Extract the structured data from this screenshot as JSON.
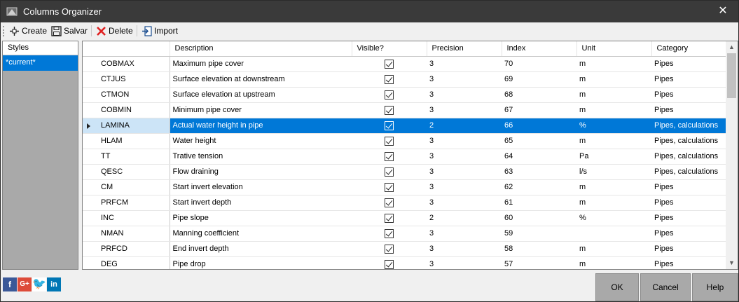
{
  "window": {
    "title": "Columns Organizer",
    "close_glyph": "✕"
  },
  "toolbar": {
    "create_label": "Create",
    "save_label": "Salvar",
    "delete_label": "Delete",
    "import_label": "Import"
  },
  "styles": {
    "header": "Styles",
    "items": [
      {
        "label": "*current*",
        "selected": true
      }
    ]
  },
  "grid": {
    "headers": {
      "description": "Description",
      "visible": "Visible?",
      "precision": "Precision",
      "index": "Index",
      "unit": "Unit",
      "category": "Category"
    },
    "rows": [
      {
        "name": "COBMAX",
        "description": "Maximum pipe cover",
        "visible": true,
        "precision": "3",
        "index": "70",
        "unit": "m",
        "category": "Pipes"
      },
      {
        "name": "CTJUS",
        "description": "Surface elevation at downstream",
        "visible": true,
        "precision": "3",
        "index": "69",
        "unit": "m",
        "category": "Pipes"
      },
      {
        "name": "CTMON",
        "description": "Surface elevation at upstream",
        "visible": true,
        "precision": "3",
        "index": "68",
        "unit": "m",
        "category": "Pipes"
      },
      {
        "name": "COBMIN",
        "description": "Minimum pipe cover",
        "visible": true,
        "precision": "3",
        "index": "67",
        "unit": "m",
        "category": "Pipes"
      },
      {
        "name": "LAMINA",
        "description": "Actual water height in pipe",
        "visible": true,
        "precision": "2",
        "index": "66",
        "unit": "%",
        "category": "Pipes, calculations",
        "selected": true
      },
      {
        "name": "HLAM",
        "description": "Water height",
        "visible": true,
        "precision": "3",
        "index": "65",
        "unit": "m",
        "category": "Pipes, calculations"
      },
      {
        "name": "TT",
        "description": "Trative tension",
        "visible": true,
        "precision": "3",
        "index": "64",
        "unit": "Pa",
        "category": "Pipes, calculations"
      },
      {
        "name": "QESC",
        "description": "Flow draining",
        "visible": true,
        "precision": "3",
        "index": "63",
        "unit": "l/s",
        "category": "Pipes, calculations"
      },
      {
        "name": "CM",
        "description": "Start invert elevation",
        "visible": true,
        "precision": "3",
        "index": "62",
        "unit": "m",
        "category": "Pipes"
      },
      {
        "name": "PRFCM",
        "description": "Start invert depth",
        "visible": true,
        "precision": "3",
        "index": "61",
        "unit": "m",
        "category": "Pipes"
      },
      {
        "name": "INC",
        "description": "Pipe slope",
        "visible": true,
        "precision": "2",
        "index": "60",
        "unit": "%",
        "category": "Pipes"
      },
      {
        "name": "NMAN",
        "description": "Manning coefficient",
        "visible": true,
        "precision": "3",
        "index": "59",
        "unit": "",
        "category": "Pipes"
      },
      {
        "name": "PRFCD",
        "description": "End invert depth",
        "visible": true,
        "precision": "3",
        "index": "58",
        "unit": "m",
        "category": "Pipes"
      },
      {
        "name": "DEG",
        "description": "Pipe drop",
        "visible": true,
        "precision": "3",
        "index": "57",
        "unit": "m",
        "category": "Pipes"
      }
    ]
  },
  "social": {
    "facebook_glyph": "f",
    "googleplus_glyph": "G+",
    "twitter_glyph": "🐦",
    "linkedin_glyph": "in"
  },
  "buttons": {
    "ok": "OK",
    "cancel": "Cancel",
    "help": "Help"
  },
  "colors": {
    "selection": "#0078d7",
    "titlebar": "#3a3a3a",
    "panel": "#a9a9a9"
  }
}
